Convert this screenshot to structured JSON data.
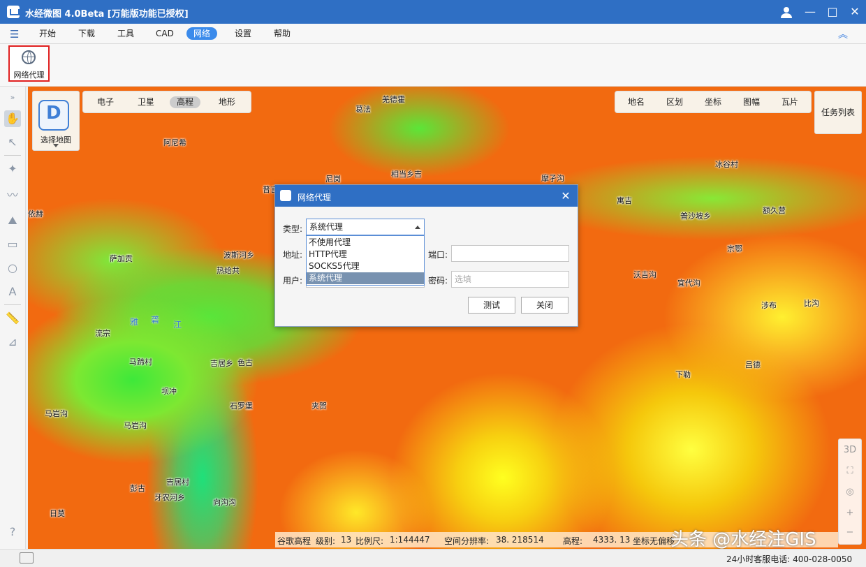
{
  "app": {
    "title": "水经微图 4.0Beta [万能版功能已授权]"
  },
  "window_controls": {
    "user_icon": "user-icon",
    "min": "—",
    "max": "□",
    "close": "✕"
  },
  "menu": {
    "items": [
      "开始",
      "下载",
      "工具",
      "CAD",
      "网络",
      "设置",
      "帮助"
    ],
    "active": "网络",
    "collapse_icon": "︽"
  },
  "toolbar": {
    "proxy_label": "网络代理"
  },
  "basemap": {
    "select_label": "选择地图",
    "types": [
      "电子",
      "卫星",
      "高程",
      "地形"
    ],
    "active": "高程"
  },
  "overlays": {
    "items": [
      "地名",
      "区划",
      "坐标",
      "图幅",
      "瓦片"
    ]
  },
  "tasks_label": "任务列表",
  "map_controls": {
    "three_d": "3D"
  },
  "places": [
    {
      "name": "羌德霍"
    },
    {
      "name": "葛法"
    },
    {
      "name": "阿尼希"
    },
    {
      "name": "尼岗"
    },
    {
      "name": "相当乡吉"
    },
    {
      "name": "摩孑沟"
    },
    {
      "name": "冰谷村"
    },
    {
      "name": "普言"
    },
    {
      "name": "寓吉"
    },
    {
      "name": "普沙坡乡"
    },
    {
      "name": "额久营"
    },
    {
      "name": "依赫"
    },
    {
      "name": "萨加贡"
    },
    {
      "name": "波斯河乡"
    },
    {
      "name": "热给共"
    },
    {
      "name": "宗鄂"
    },
    {
      "name": "沃吉沟"
    },
    {
      "name": "宜代沟"
    },
    {
      "name": "涉布"
    },
    {
      "name": "比沟"
    },
    {
      "name": "流宗"
    },
    {
      "name": "马蹄村"
    },
    {
      "name": "吉居乡"
    },
    {
      "name": "色古"
    },
    {
      "name": "坝冲"
    },
    {
      "name": "吕德"
    },
    {
      "name": "下勒"
    },
    {
      "name": "马岩沟"
    },
    {
      "name": "石罗堡"
    },
    {
      "name": "夹贺"
    },
    {
      "name": "马岩沟"
    },
    {
      "name": "彭古"
    },
    {
      "name": "吉居村"
    },
    {
      "name": "牙农河乡"
    },
    {
      "name": "向沟沟"
    },
    {
      "name": "日莫"
    }
  ],
  "river": [
    "雅",
    "砻",
    "江"
  ],
  "info": {
    "source": "谷歌高程",
    "level_label": "级别:",
    "level": "13",
    "scale_label": "比例尺:",
    "scale": "1:144447",
    "resolution_label": "空间分辨率:",
    "resolution": "38. 218514",
    "elevation_label": "高程:",
    "elevation": "4333. 13",
    "coord_label": "坐标无偏移"
  },
  "status": {
    "hotline": "24小时客服电话: 400-028-0050"
  },
  "watermark": "头条 @水经注GIS",
  "dialog": {
    "title": "网络代理",
    "type_label": "类型:",
    "type_value": "系统代理",
    "options": [
      "不使用代理",
      "HTTP代理",
      "SOCKS5代理",
      "系统代理"
    ],
    "selected_option": "系统代理",
    "address_label": "地址:",
    "port_label": "端口:",
    "user_label": "用户:",
    "password_label": "密码:",
    "password_placeholder": "选填",
    "test_button": "测试",
    "close_button": "关闭"
  }
}
